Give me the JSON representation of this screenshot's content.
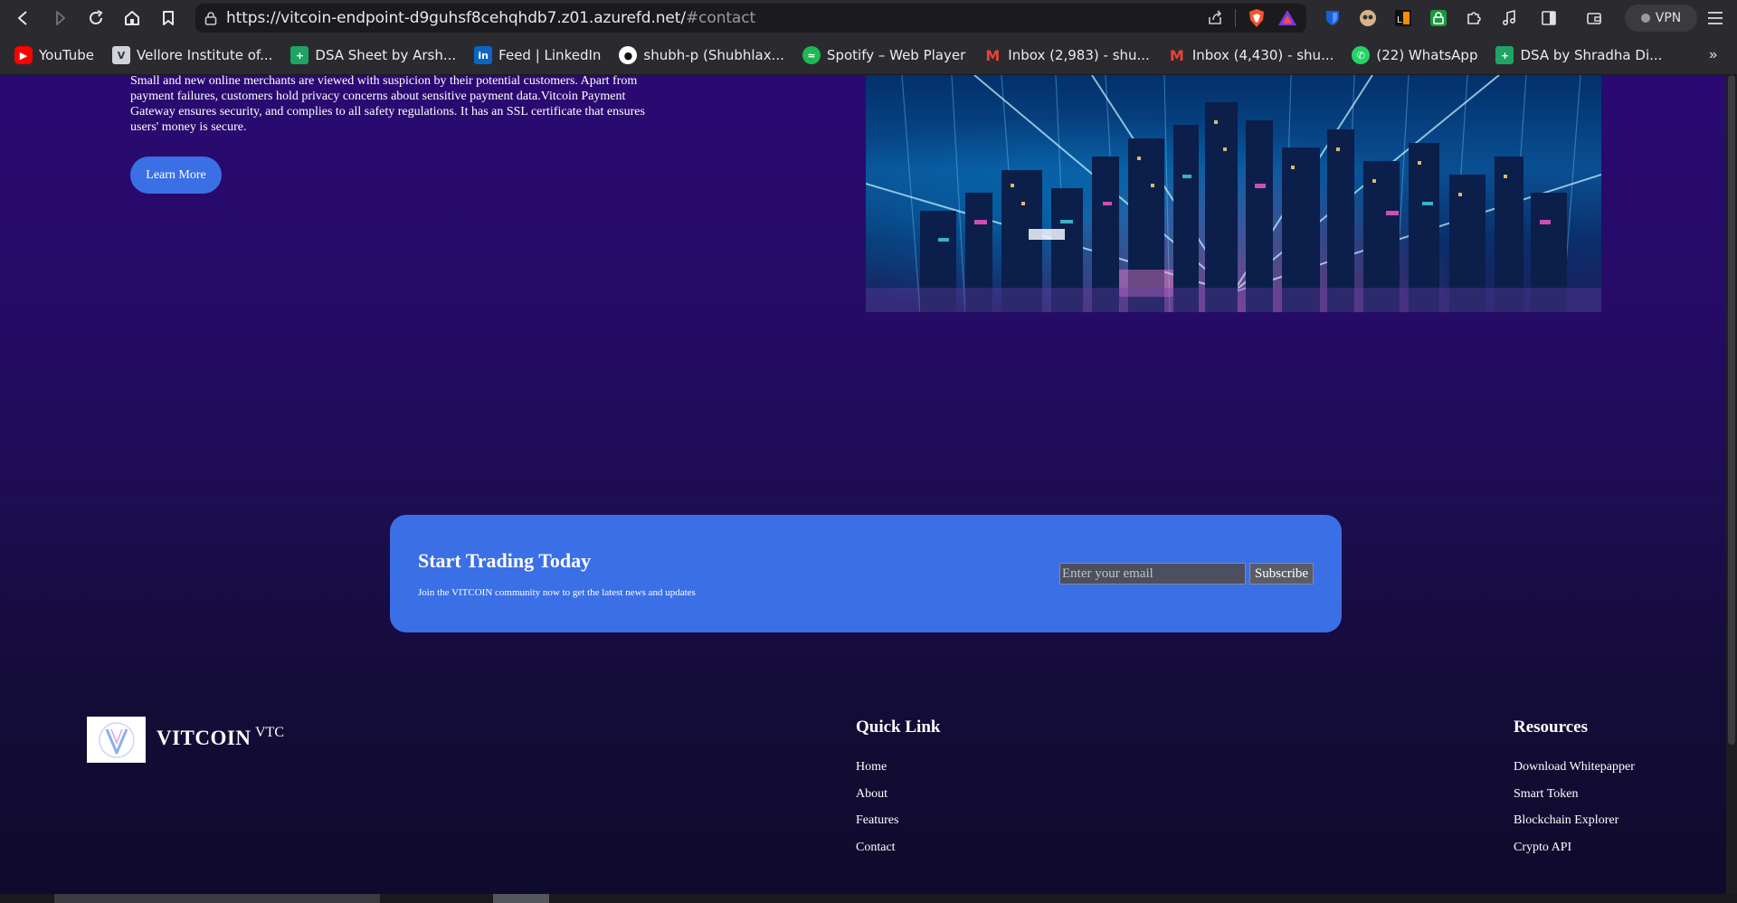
{
  "browser": {
    "url_main": "https://vitcoin-endpoint-d9guhsf8cehqhdb7.z01.azurefd.net/",
    "url_fragment": "#contact",
    "vpn_label": "VPN",
    "bookmarks": [
      {
        "label": "YouTube",
        "icon": "youtube-icon",
        "color": "#ff0000"
      },
      {
        "label": "Vellore Institute of...",
        "icon": "vit-icon",
        "color": "#cfd4dc"
      },
      {
        "label": "DSA Sheet by Arsh...",
        "icon": "sheets-icon",
        "color": "#1fa463"
      },
      {
        "label": "Feed | LinkedIn",
        "icon": "linkedin-icon",
        "color": "#0a66c2"
      },
      {
        "label": "shubh-p (Shubhlax...",
        "icon": "github-icon",
        "color": "#ffffff"
      },
      {
        "label": "Spotify – Web Player",
        "icon": "spotify-icon",
        "color": "#1db954"
      },
      {
        "label": "Inbox (2,983) - shu...",
        "icon": "gmail-icon",
        "color": "#ea4335"
      },
      {
        "label": "Inbox (4,430) - shu...",
        "icon": "gmail-icon",
        "color": "#ea4335"
      },
      {
        "label": "(22) WhatsApp",
        "icon": "whatsapp-icon",
        "color": "#25d366"
      },
      {
        "label": "DSA by Shradha Di...",
        "icon": "sheets-icon",
        "color": "#1fa463"
      }
    ],
    "more_label": "»"
  },
  "intro": {
    "text": "Small and new online merchants are viewed with suspicion by their potential customers. Apart from payment failures, customers hold privacy concerns about sensitive payment data.Vitcoin Payment Gateway ensures security, and complies to all safety regulations. It has an SSL certificate that ensures users' money is secure.",
    "button": "Learn More"
  },
  "cta": {
    "title": "Start Trading Today",
    "subtitle": "Join the VITCOIN community now to get the latest news and updates",
    "email_placeholder": "Enter your email",
    "button": "Subscribe"
  },
  "footer": {
    "brand": "VITCOIN",
    "ticker": "VTC",
    "quick_links": {
      "title": "Quick Link",
      "items": [
        "Home",
        "About",
        "Features",
        "Contact"
      ]
    },
    "resources": {
      "title": "Resources",
      "items": [
        "Download Whitepapper",
        "Smart Token",
        "Blockchain Explorer",
        "Crypto API"
      ]
    }
  },
  "colors": {
    "accent_blue": "#3b6fe6",
    "page_top": "#2a0a72",
    "page_bottom": "#0f0b2c"
  }
}
